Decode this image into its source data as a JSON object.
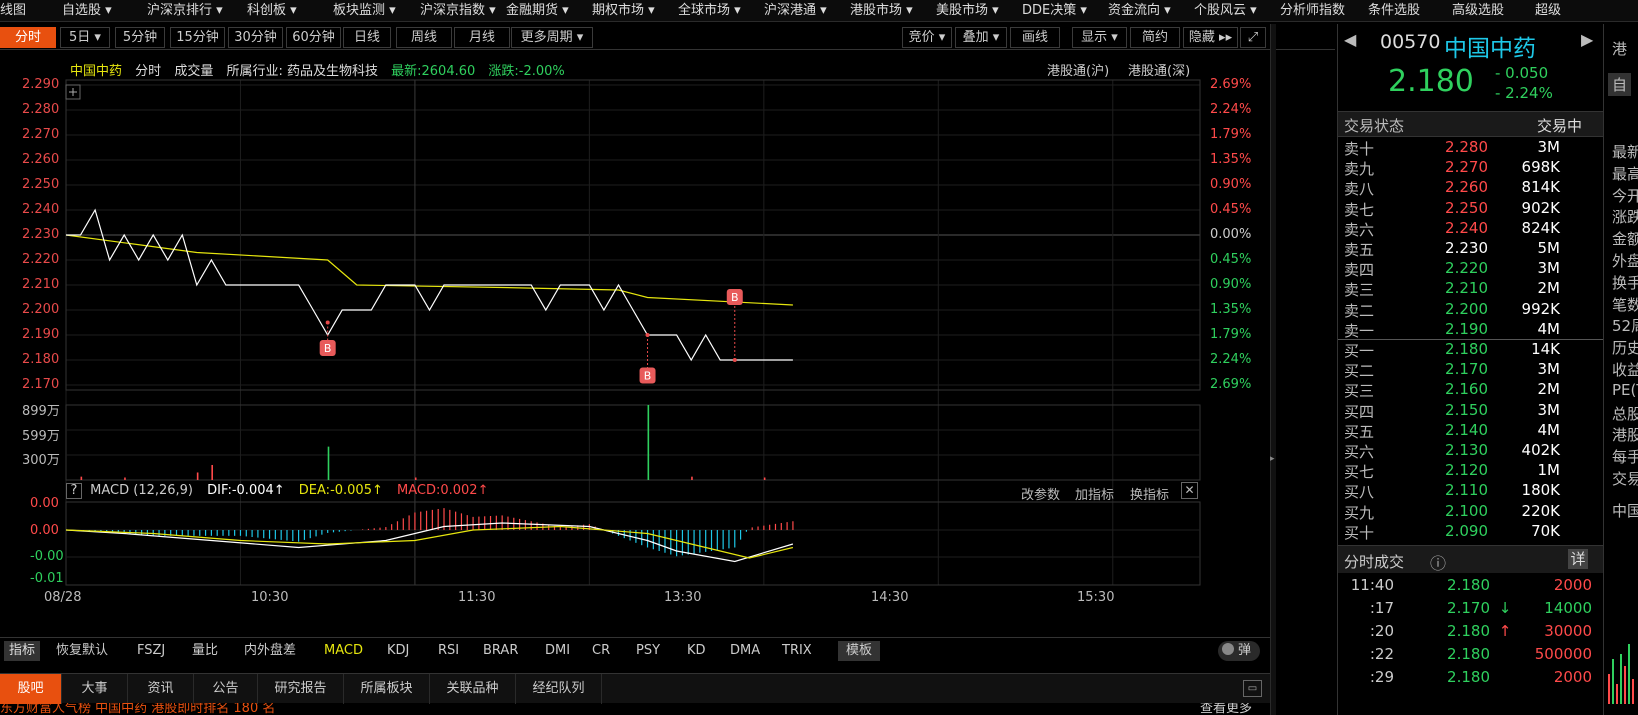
{
  "topmenu": {
    "items": [
      "线图",
      "自选股 ▾",
      "沪深京排行 ▾",
      "科创板 ▾",
      "板块监测 ▾",
      "沪深京指数 ▾",
      "金融期货 ▾",
      "期权市场 ▾",
      "全球市场 ▾",
      "沪深港通 ▾",
      "港股市场 ▾",
      "美股市场 ▾",
      "DDE决策 ▾",
      "资金流向 ▾",
      "个股风云 ▾",
      "分析师指数",
      "条件选股",
      "高级选股",
      "超级"
    ]
  },
  "periods": {
    "items": [
      "分时",
      "5日 ▾",
      "5分钟",
      "15分钟",
      "30分钟",
      "60分钟",
      "日线",
      "周线",
      "月线",
      "更多周期 ▾"
    ],
    "active": "分时"
  },
  "tools": {
    "items": [
      "竞价 ▾",
      "叠加 ▾",
      "画线",
      "显示 ▾",
      "简约",
      "隐藏 ▸▸"
    ]
  },
  "chart": {
    "stock_name": "中国中药",
    "mode": "分时",
    "volume_label": "成交量",
    "industry": "所属行业: 药品及生物科技",
    "latest": "最新:2604.60",
    "change": "涨跌:-2.00%",
    "hk_sh": "港股通(沪)",
    "hk_sz": "港股通(深)",
    "y_labels": [
      "2.290",
      "2.280",
      "2.270",
      "2.260",
      "2.250",
      "2.240",
      "2.230",
      "2.220",
      "2.210",
      "2.200",
      "2.190",
      "2.180",
      "2.170"
    ],
    "pct_labels": [
      "2.69%",
      "2.24%",
      "1.79%",
      "1.35%",
      "0.90%",
      "0.45%",
      "0.00%",
      "0.45%",
      "0.90%",
      "1.35%",
      "1.79%",
      "2.24%",
      "2.69%"
    ],
    "vol_labels": [
      "899万",
      "599万",
      "300万"
    ],
    "x_labels": [
      "08/28",
      "10:30",
      "11:30",
      "13:30",
      "14:30",
      "15:30"
    ],
    "trade_marker": "B"
  },
  "macd": {
    "help": "?",
    "title": "MACD (12,26,9)",
    "dif": "DIF:-0.004↑",
    "dea": "DEA:-0.005↑",
    "macd": "MACD:0.002↑",
    "buttons": [
      "改参数",
      "加指标",
      "换指标"
    ],
    "close": "✕",
    "y_labels": [
      "0.00",
      "0.00",
      "-0.00",
      "-0.01"
    ]
  },
  "indicators": {
    "label": "指标",
    "items": [
      "恢复默认",
      "FSZJ",
      "量比",
      "内外盘差",
      "MACD",
      "KDJ",
      "RSI",
      "BRAR",
      "DMI",
      "CR",
      "PSY",
      "KD",
      "DMA",
      "TRIX"
    ],
    "active": "MACD",
    "template": "模板",
    "toggle": "弹"
  },
  "bottom_tabs": {
    "items": [
      "股吧",
      "大事",
      "资讯",
      "公告",
      "研究报告",
      "所属板块",
      "关联品种",
      "经纪队列"
    ],
    "active": "股吧",
    "ticker_text": "东方财富人气榜   中国中药   港股即时排名  180  名",
    "more": "查看更多"
  },
  "quote": {
    "code": "00570",
    "name": "中国中药",
    "price": "2.180",
    "change": "- 0.050",
    "change_pct": "- 2.24%",
    "status_label": "交易状态",
    "status": "交易中",
    "colors": {
      "up": "#ff4a4a",
      "down": "#2fd05e",
      "flat": "#ffffff",
      "accent": "#e8500f",
      "cyan": "#1ec8e8",
      "yellow": "#e6e60e"
    }
  },
  "orderbook": {
    "sell": [
      {
        "label": "卖十",
        "price": "2.280",
        "vol": "3M"
      },
      {
        "label": "卖九",
        "price": "2.270",
        "vol": "698K"
      },
      {
        "label": "卖八",
        "price": "2.260",
        "vol": "814K"
      },
      {
        "label": "卖七",
        "price": "2.250",
        "vol": "902K"
      },
      {
        "label": "卖六",
        "price": "2.240",
        "vol": "824K"
      },
      {
        "label": "卖五",
        "price": "2.230",
        "vol": "5M"
      },
      {
        "label": "卖四",
        "price": "2.220",
        "vol": "3M"
      },
      {
        "label": "卖三",
        "price": "2.210",
        "vol": "2M"
      },
      {
        "label": "卖二",
        "price": "2.200",
        "vol": "992K"
      },
      {
        "label": "卖一",
        "price": "2.190",
        "vol": "4M"
      }
    ],
    "buy": [
      {
        "label": "买一",
        "price": "2.180",
        "vol": "14K"
      },
      {
        "label": "买二",
        "price": "2.170",
        "vol": "3M"
      },
      {
        "label": "买三",
        "price": "2.160",
        "vol": "2M"
      },
      {
        "label": "买四",
        "price": "2.150",
        "vol": "3M"
      },
      {
        "label": "买五",
        "price": "2.140",
        "vol": "4M"
      },
      {
        "label": "买六",
        "price": "2.130",
        "vol": "402K"
      },
      {
        "label": "买七",
        "price": "2.120",
        "vol": "1M"
      },
      {
        "label": "买八",
        "price": "2.110",
        "vol": "180K"
      },
      {
        "label": "买九",
        "price": "2.100",
        "vol": "220K"
      },
      {
        "label": "买十",
        "price": "2.090",
        "vol": "70K"
      }
    ]
  },
  "ticks": {
    "title": "分时成交",
    "info": "ⓘ",
    "detail": "详",
    "rows": [
      {
        "time": "11:40",
        "price": "2.180",
        "arrow": "",
        "vol": "2000"
      },
      {
        "time": ":17",
        "price": "2.170",
        "arrow": "↓",
        "vol": "14000"
      },
      {
        "time": ":20",
        "price": "2.180",
        "arrow": "↑",
        "vol": "30000"
      },
      {
        "time": ":22",
        "price": "2.180",
        "arrow": "",
        "vol": "500000"
      },
      {
        "time": ":29",
        "price": "2.180",
        "arrow": "",
        "vol": "2000"
      }
    ]
  },
  "farright": {
    "top": "港",
    "btn": "自",
    "items": [
      "最新",
      "最高",
      "今开",
      "涨跌",
      "金额",
      "外盘",
      "换手",
      "笔数",
      "52周",
      "历史",
      "收益",
      "PE(T",
      "总股",
      "港股",
      "每手",
      "交易"
    ],
    "bottom": "中国"
  },
  "chart_data": {
    "type": "line",
    "x_range": [
      "09:30",
      "16:00"
    ],
    "ylim": [
      2.17,
      2.29
    ],
    "price": [
      [
        0,
        2.23
      ],
      [
        5,
        2.23
      ],
      [
        10,
        2.24
      ],
      [
        15,
        2.22
      ],
      [
        20,
        2.23
      ],
      [
        25,
        2.22
      ],
      [
        30,
        2.23
      ],
      [
        35,
        2.22
      ],
      [
        40,
        2.23
      ],
      [
        45,
        2.21
      ],
      [
        50,
        2.22
      ],
      [
        55,
        2.21
      ],
      [
        60,
        2.21
      ],
      [
        70,
        2.21
      ],
      [
        80,
        2.21
      ],
      [
        85,
        2.2
      ],
      [
        90,
        2.19
      ],
      [
        95,
        2.2
      ],
      [
        105,
        2.2
      ],
      [
        110,
        2.21
      ],
      [
        120,
        2.21
      ],
      [
        125,
        2.2
      ],
      [
        130,
        2.21
      ],
      [
        150,
        2.21
      ],
      [
        160,
        2.21
      ],
      [
        165,
        2.2
      ],
      [
        170,
        2.21
      ],
      [
        180,
        2.21
      ],
      [
        185,
        2.2
      ],
      [
        190,
        2.21
      ],
      [
        195,
        2.2
      ],
      [
        200,
        2.19
      ],
      [
        210,
        2.19
      ],
      [
        215,
        2.18
      ],
      [
        220,
        2.19
      ],
      [
        225,
        2.18
      ],
      [
        250,
        2.18
      ]
    ],
    "avg": [
      [
        0,
        2.23
      ],
      [
        45,
        2.223
      ],
      [
        90,
        2.22
      ],
      [
        100,
        2.21
      ],
      [
        150,
        2.209
      ],
      [
        190,
        2.208
      ],
      [
        200,
        2.205
      ],
      [
        250,
        2.202
      ]
    ],
    "volume_max": "899万",
    "volumes": [
      [
        5,
        40
      ],
      [
        20,
        30
      ],
      [
        45,
        90
      ],
      [
        50,
        180
      ],
      [
        90,
        400
      ],
      [
        120,
        30
      ],
      [
        200,
        899
      ],
      [
        215,
        40
      ],
      [
        240,
        30
      ]
    ],
    "buy_markers": [
      [
        90,
        2.195,
        2.188
      ],
      [
        200,
        2.19,
        2.177
      ],
      [
        230,
        2.18,
        2.202
      ]
    ],
    "macd_dif": [
      [
        0,
        0.0
      ],
      [
        20,
        -0.001
      ],
      [
        50,
        -0.003
      ],
      [
        80,
        -0.005
      ],
      [
        110,
        -0.003
      ],
      [
        130,
        0.001
      ],
      [
        150,
        0.002
      ],
      [
        180,
        0.001
      ],
      [
        200,
        -0.003
      ],
      [
        210,
        -0.006
      ],
      [
        230,
        -0.009
      ],
      [
        250,
        -0.004
      ]
    ],
    "macd_dea": [
      [
        0,
        0.0
      ],
      [
        30,
        -0.001
      ],
      [
        60,
        -0.003
      ],
      [
        90,
        -0.004
      ],
      [
        120,
        -0.003
      ],
      [
        140,
        0.0
      ],
      [
        170,
        0.001
      ],
      [
        200,
        -0.001
      ],
      [
        220,
        -0.005
      ],
      [
        235,
        -0.008
      ],
      [
        250,
        -0.005
      ]
    ]
  }
}
